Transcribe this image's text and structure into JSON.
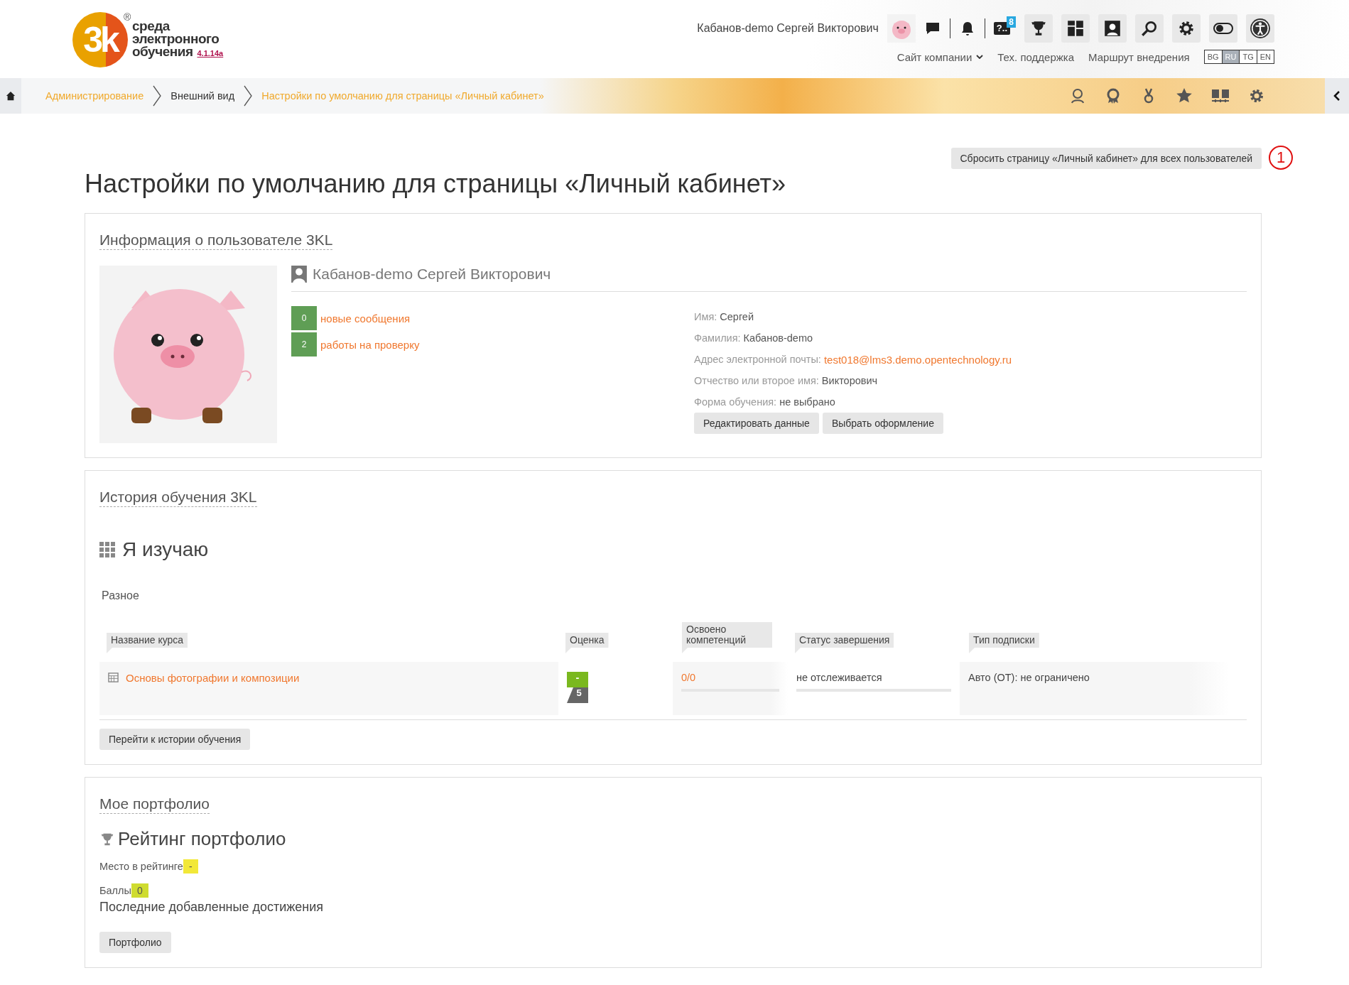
{
  "logo": {
    "mark": "3k",
    "registered": "®",
    "lines": [
      "среда",
      "электронного",
      "обучения"
    ],
    "version": "4.1.14a"
  },
  "user_menu": {
    "name": "Кабанов-demo Сергей Викторович",
    "help_icon": "?..",
    "help_badge": "8"
  },
  "top_links": [
    {
      "label": "Сайт компании",
      "kind": "dropdown"
    },
    {
      "label": "Тех. поддержка",
      "kind": "link"
    },
    {
      "label": "Маршрут внедрения",
      "kind": "link"
    }
  ],
  "languages": [
    {
      "label": "BG",
      "selected": false
    },
    {
      "label": "RU",
      "selected": true
    },
    {
      "label": "TG",
      "selected": false
    },
    {
      "label": "EN",
      "selected": false
    }
  ],
  "breadcrumbs": [
    {
      "label": "Администрирование",
      "kind": "link"
    },
    {
      "label": "Внешний вид",
      "kind": "plain"
    },
    {
      "label": "Настройки по умолчанию для страницы «Личный кабинет»",
      "kind": "link"
    }
  ],
  "reset_button": "Сбросить страницу «Личный кабинет» для всех пользователей",
  "annotation": "1",
  "title": "Настройки по умолчанию для страницы «Личный кабинет»",
  "user_info": {
    "heading": "Информация о пользователе 3KL",
    "full_name": "Кабанов-demo Сергей Викторович",
    "counters": [
      {
        "count": "0",
        "label": "новые сообщения"
      },
      {
        "count": "2",
        "label": "работы на проверку"
      }
    ],
    "fields": [
      {
        "label": "Имя:",
        "value": "Сергей",
        "kind": "text"
      },
      {
        "label": "Фамилия:",
        "value": "Кабанов-demo",
        "kind": "text"
      },
      {
        "label": "Адрес электронной почты:",
        "value": "test018@lms3.demo.opentechnology.ru",
        "kind": "link"
      },
      {
        "label": "Отчество или второе имя:",
        "value": "Викторович",
        "kind": "text"
      },
      {
        "label": "Форма обучения:",
        "value": "не выбрано",
        "kind": "text"
      }
    ],
    "buttons": [
      "Редактировать данные",
      "Выбрать оформление"
    ]
  },
  "history": {
    "heading": "История обучения 3KL",
    "subheading": "Я изучаю",
    "category": "Разное",
    "table": {
      "columns": [
        "Название курса",
        "Оценка",
        "Освоено компетенций",
        "Статус завершения",
        "Тип подписки"
      ],
      "rows": [
        {
          "course": "Основы фотографии и композиции",
          "grade": "-",
          "max_grade": "5",
          "competences": {
            "text": "0/0",
            "level": 0
          },
          "status": {
            "text": "не отслеживается",
            "level": 0
          },
          "subscription": "Авто (ОТ): не ограничено"
        }
      ]
    },
    "button": "Перейти к истории обучения"
  },
  "portfolio": {
    "heading": "Мое портфолио",
    "subheading": "Рейтинг портфолио",
    "stats": [
      {
        "label": "Место в рейтинге",
        "value": "-",
        "color": "#f2e838"
      },
      {
        "label": "Баллы",
        "value": "0",
        "color": "#cfdc30"
      }
    ],
    "recent": "Последние добавленные достижения",
    "button": "Портфолио"
  }
}
